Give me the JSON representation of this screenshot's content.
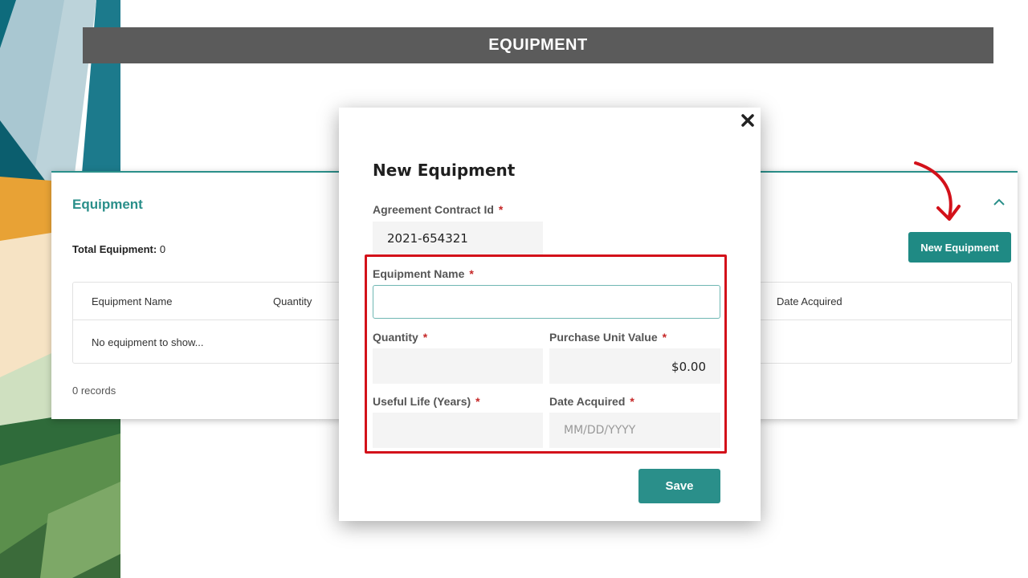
{
  "slide": {
    "title": "EQUIPMENT"
  },
  "card": {
    "title": "Equipment",
    "total_label": "Total Equipment:",
    "total_value": "0",
    "new_button": "New Equipment",
    "columns": [
      "Equipment Name",
      "Quantity",
      "Date Acquired"
    ],
    "empty_text": "No equipment to show...",
    "records": "0 records"
  },
  "modal": {
    "title": "New Equipment",
    "required_mark": "*",
    "contract_label": "Agreement Contract Id",
    "contract_value": "2021-654321",
    "name_label": "Equipment Name",
    "name_value": "",
    "quantity_label": "Quantity",
    "quantity_value": "",
    "puv_label": "Purchase Unit Value",
    "puv_value": "$0.00",
    "life_label": "Useful Life (Years)",
    "life_value": "",
    "date_label": "Date Acquired",
    "date_placeholder": "MM/DD/YYYY",
    "save_button": "Save"
  },
  "colors": {
    "accent": "#2a8f8a",
    "highlight": "#d3111a",
    "banner": "#5b5b5b"
  },
  "icons": [
    "close-icon",
    "chevron-up-icon",
    "arrow-annotation-icon"
  ]
}
